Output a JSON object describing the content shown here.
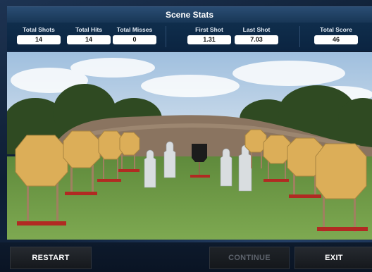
{
  "stats": {
    "title": "Scene Stats",
    "items": [
      {
        "label": "Total Shots",
        "value": "14"
      },
      {
        "label": "Total Hits",
        "value": "14"
      },
      {
        "label": "Total Misses",
        "value": "0"
      },
      {
        "label": "First Shot",
        "value": "1.31"
      },
      {
        "label": "Last Shot",
        "value": "7.03"
      },
      {
        "label": "Total Score",
        "value": "46"
      }
    ]
  },
  "buttons": {
    "restart": "RESTART",
    "continue": "CONTINUE",
    "exit": "EXIT"
  },
  "colors": {
    "panel": "#123352",
    "header": "#2a4d73",
    "target_tan": "#dcae58",
    "target_stand": "#b12a22",
    "silhouette": "#d9dde0",
    "active_target": "#1c1c1c",
    "grass": "#6f9a45",
    "dirt": "#8a7460"
  }
}
